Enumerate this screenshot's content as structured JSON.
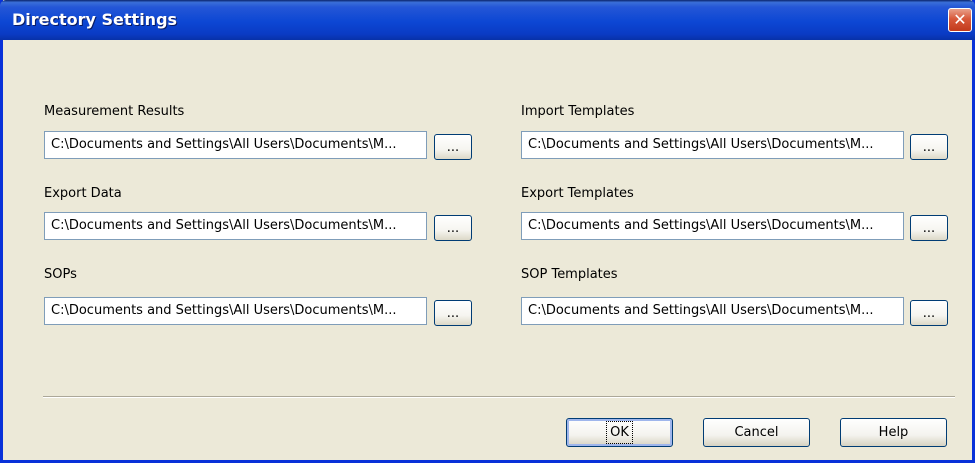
{
  "window": {
    "title": "Directory Settings",
    "close_glyph": "✕"
  },
  "fields": {
    "measurement_results": {
      "label": "Measurement Results",
      "value": "C:\\Documents and Settings\\All Users\\Documents\\M..."
    },
    "export_data": {
      "label": "Export Data",
      "value": "C:\\Documents and Settings\\All Users\\Documents\\M..."
    },
    "sops": {
      "label": "SOPs",
      "value": "C:\\Documents and Settings\\All Users\\Documents\\M..."
    },
    "import_templates": {
      "label": "Import Templates",
      "value": "C:\\Documents and Settings\\All Users\\Documents\\M..."
    },
    "export_templates": {
      "label": "Export Templates",
      "value": "C:\\Documents and Settings\\All Users\\Documents\\M..."
    },
    "sop_templates": {
      "label": "SOP Templates",
      "value": "C:\\Documents and Settings\\All Users\\Documents\\M..."
    }
  },
  "browse_label": "...",
  "buttons": {
    "ok": "OK",
    "cancel": "Cancel",
    "help": "Help"
  }
}
